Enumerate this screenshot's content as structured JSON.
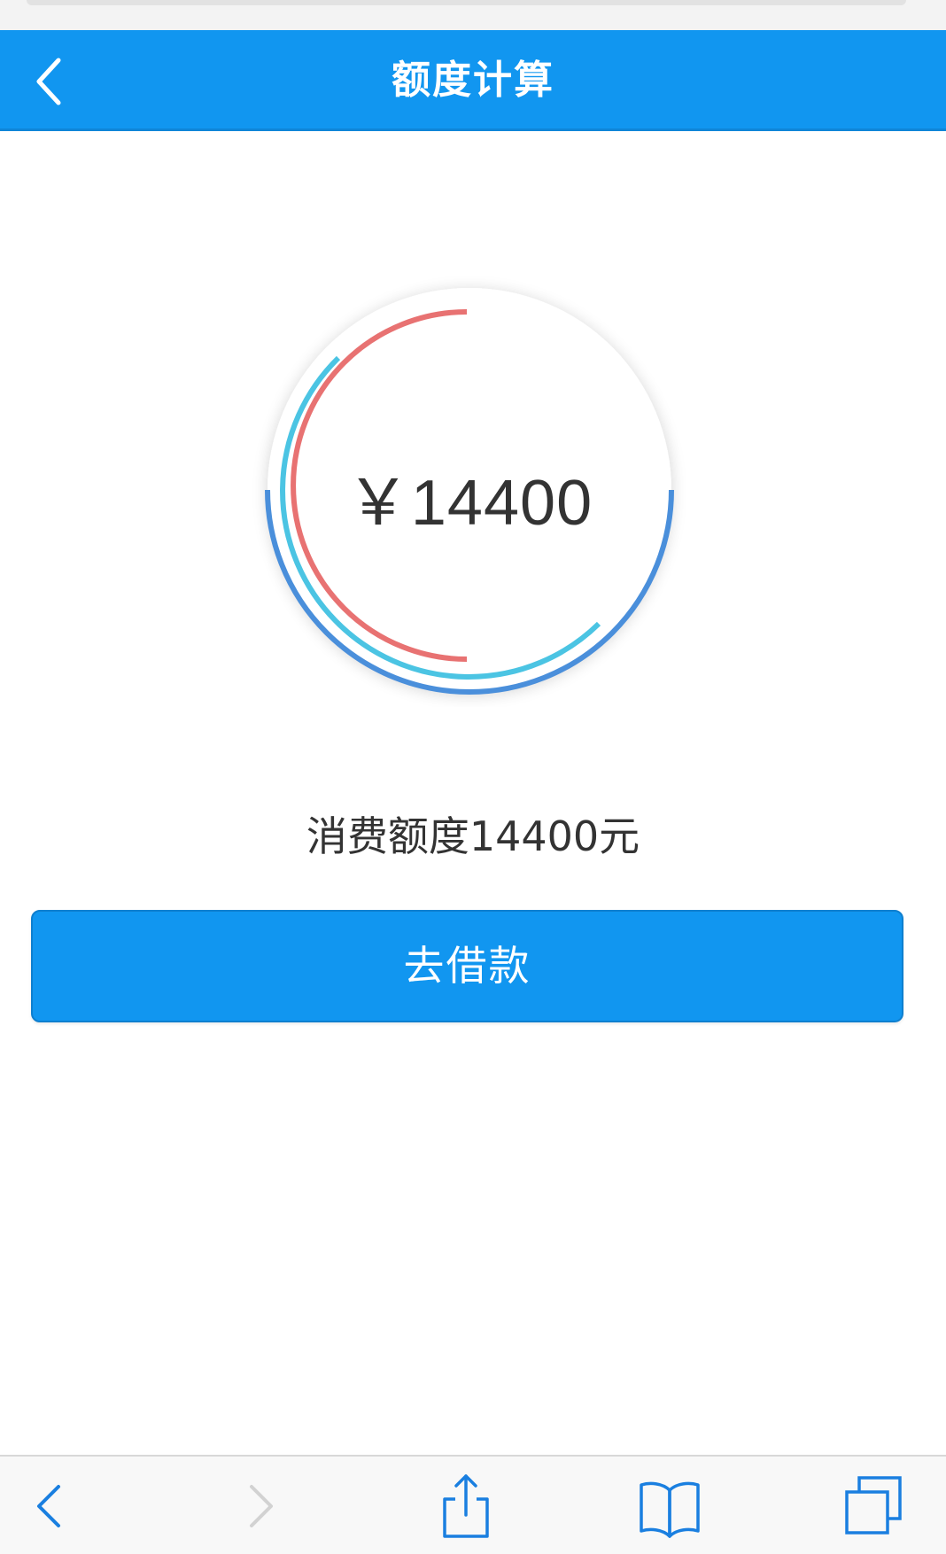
{
  "nav": {
    "title": "额度计算",
    "back_icon": "chevron-left-icon",
    "bar_color": "#1196f0"
  },
  "gauge": {
    "amount_text": "￥14400",
    "arc_colors": {
      "outer": "#4a8fdb",
      "middle": "#4bc4e3",
      "inner": "#e87272"
    }
  },
  "summary": {
    "limit_text": "消费额度14400元"
  },
  "actions": {
    "borrow_label": "去借款"
  },
  "browser_toolbar": {
    "items": [
      {
        "icon": "back-arrow-icon",
        "enabled": true
      },
      {
        "icon": "forward-arrow-icon",
        "enabled": false
      },
      {
        "icon": "share-icon",
        "enabled": true
      },
      {
        "icon": "bookmarks-icon",
        "enabled": true
      },
      {
        "icon": "tabs-icon",
        "enabled": true
      }
    ],
    "tint_color": "#1a7fe0"
  }
}
